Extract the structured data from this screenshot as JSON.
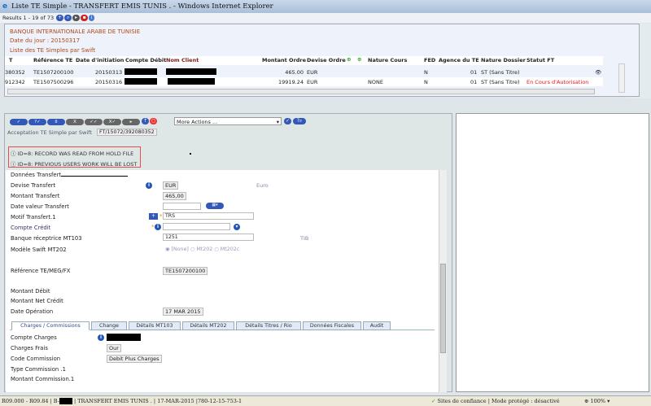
{
  "window": {
    "title": "Liste TE Simple - TRANSFERT EMIS TUNIS . - Windows Internet Explorer"
  },
  "results": {
    "text": "Results 1 - 19 of 73"
  },
  "list": {
    "bank": "BANQUE INTERNATIONALE ARABE DE TUNISIE",
    "date": "Date du jour : 20150317",
    "subtitle": "Liste des TE Simples par Swift",
    "columns": [
      "T",
      "Référence TE",
      "Date d'initiation",
      "Compte Débit",
      "Nom Client",
      "Montant Ordre",
      "Devise Ordre",
      "Nature Cours",
      "FED",
      "Agence du TE",
      "Nature Dossier",
      "Statut FT"
    ],
    "rows": [
      {
        "t": "380352",
        "ref": "TE1507200100",
        "date": "20150313",
        "montant": "465.00",
        "devise": "EUR",
        "nature": "",
        "fed": "N",
        "agence": "01",
        "dossier": "ST (Sans Titre)",
        "statut": ""
      },
      {
        "t": "912342",
        "ref": "TE1507500296",
        "date": "20150316",
        "montant": "19919.24",
        "devise": "EUR",
        "nature": "NONE",
        "fed": "N",
        "agence": "01",
        "dossier": "ST (Sans Titre)",
        "statut": "En Cours d'Autorisation"
      }
    ]
  },
  "toolbar": {
    "more_actions": "More Actions ...",
    "label": "Acceptation TE Simple par Swift",
    "id": "FT/15072/392080352"
  },
  "messages": [
    "ID=8: RECORD WAS READ FROM HOLD FILE",
    "ID=8: PREVIOUS USERS WORK WILL BE LOST"
  ],
  "form": {
    "section": "Données Transfert",
    "devise_label": "Devise Transfert",
    "devise": "EUR",
    "devise_name": "Euro",
    "montant_label": "Montant Transfert",
    "montant": "465,00",
    "date_valeur_label": "Date valeur Transfert",
    "motif_label": "Motif Transfert.1",
    "motif": "TRS",
    "compte_credit_label": "Compte Crédit",
    "banque_label": "Banque réceptrice MT103",
    "banque": "1251",
    "banque_name": "TIB",
    "modele_label": "Modèle Swift MT202",
    "modele_options": [
      "[None]",
      "Mt202",
      "Mt202c"
    ],
    "reference_label": "Référence TE/MEG/FX",
    "reference": "TE1507200100",
    "montant_debit_label": "Montant Débit",
    "montant_net_label": "Montant Net Crédit",
    "date_op_label": "Date Opération",
    "date_op": "17 MAR 2015"
  },
  "tabs": [
    "Charges / Commissions",
    "Change",
    "Détails MT103",
    "Détails MT202",
    "Détails Titres / Rio",
    "Données Fiscales",
    "Audit"
  ],
  "charges": {
    "compte_label": "Compte Charges",
    "frais_label": "Charges Frais",
    "frais": "Our",
    "code_label": "Code Commission",
    "code": "Debit Plus Charges",
    "type_label": "Type Commission .1",
    "montant_label": "Montant Commission.1"
  },
  "status": {
    "left_a": "R09.000 - R09.84 | B-",
    "left_b": "| TRANSFERT EMIS TUNIS . | 17-MAR-2015 |780-12-15-753-1",
    "zone": "Sites de confiance | Mode protégé : désactivé",
    "zoom": "100%"
  }
}
